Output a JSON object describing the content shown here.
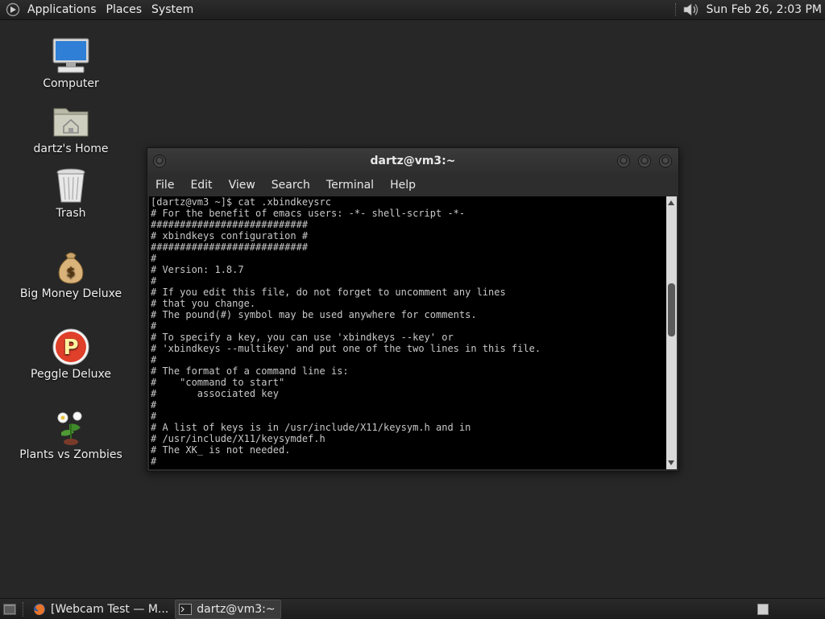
{
  "top_panel": {
    "menus": [
      "Applications",
      "Places",
      "System"
    ],
    "clock": "Sun Feb 26,  2:03 PM",
    "icons": {
      "logo": "gnome-foot-icon",
      "volume": "volume-icon"
    }
  },
  "desktop": {
    "icons": [
      {
        "label": "Computer",
        "icon": "computer-icon"
      },
      {
        "label": "dartz's Home",
        "icon": "home-folder-icon"
      },
      {
        "label": "Trash",
        "icon": "trash-icon"
      },
      {
        "label": "Big Money Deluxe",
        "icon": "money-bag-icon"
      },
      {
        "label": "Peggle Deluxe",
        "icon": "peggle-icon"
      },
      {
        "label": "Plants vs Zombies",
        "icon": "plant-icon"
      }
    ]
  },
  "terminal_window": {
    "title": "dartz@vm3:~",
    "menu": [
      "File",
      "Edit",
      "View",
      "Search",
      "Terminal",
      "Help"
    ],
    "lines": [
      "[dartz@vm3 ~]$ cat .xbindkeysrc",
      "# For the benefit of emacs users: -*- shell-script -*-",
      "###########################",
      "# xbindkeys configuration #",
      "###########################",
      "#",
      "# Version: 1.8.7",
      "#",
      "# If you edit this file, do not forget to uncomment any lines",
      "# that you change.",
      "# The pound(#) symbol may be used anywhere for comments.",
      "#",
      "# To specify a key, you can use 'xbindkeys --key' or",
      "# 'xbindkeys --multikey' and put one of the two lines in this file.",
      "#",
      "# The format of a command line is:",
      "#    \"command to start\"",
      "#       associated key",
      "#",
      "#",
      "# A list of keys is in /usr/include/X11/keysym.h and in",
      "# /usr/include/X11/keysymdef.h",
      "# The XK_ is not needed.",
      "#"
    ],
    "scroll_position": 0.38
  },
  "bottom_panel": {
    "tasks": [
      {
        "label": "[Webcam Test — M...",
        "icon": "firefox-icon",
        "active": false
      },
      {
        "label": "dartz@vm3:~",
        "icon": "terminal-icon",
        "active": true
      }
    ],
    "icons": {
      "show_desktop": "show-desktop-icon",
      "workspace": "workspace-switcher-icon"
    }
  }
}
